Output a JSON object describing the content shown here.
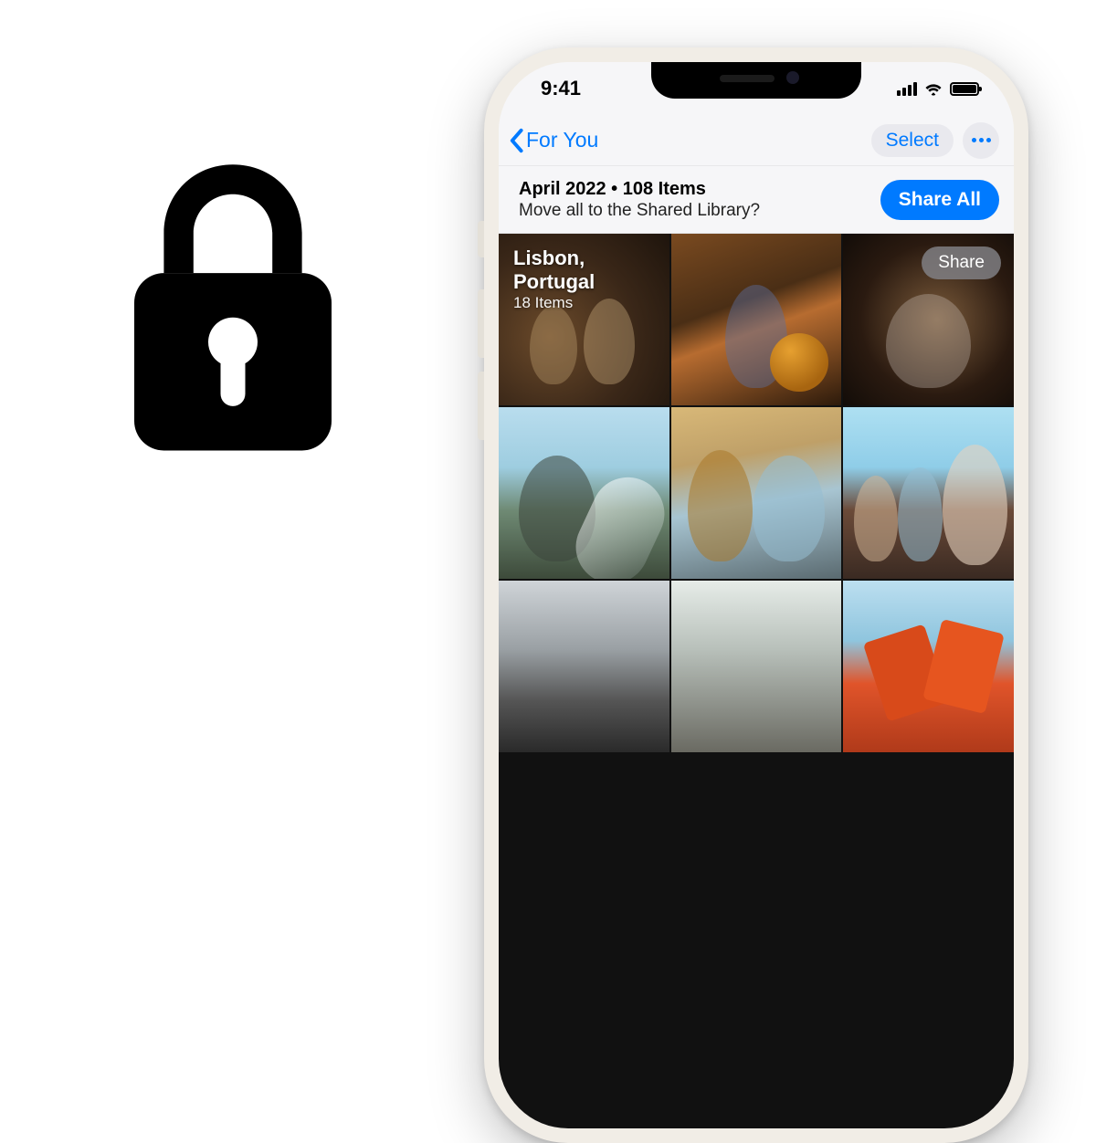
{
  "status_bar": {
    "time": "9:41",
    "signal_icon": "cellular-signal-icon",
    "wifi_icon": "wifi-icon",
    "battery_icon": "battery-full-icon"
  },
  "nav": {
    "back_label": "For You",
    "select_label": "Select",
    "more_icon": "ellipsis-icon"
  },
  "section": {
    "title_line": "April 2022 • 108 Items",
    "subtitle": "Move all to the Shared Library?",
    "share_all_label": "Share All"
  },
  "album_overlay": {
    "title": "Lisbon, Portugal",
    "count": "18 Items",
    "share_label": "Share"
  },
  "left_graphic": {
    "icon": "lock-icon"
  },
  "colors": {
    "ios_blue": "#007aff",
    "pill_gray": "#e9e9ee"
  }
}
